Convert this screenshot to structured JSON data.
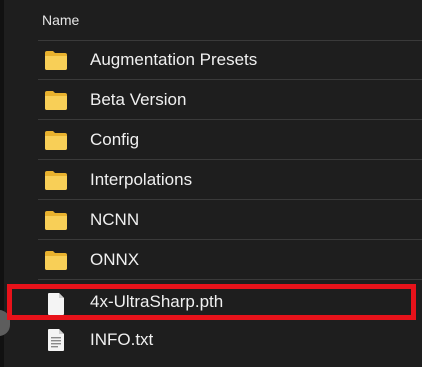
{
  "column_header": "Name",
  "files": [
    {
      "name": "Augmentation Presets",
      "type": "folder",
      "icon": "folder-icon"
    },
    {
      "name": "Beta Version",
      "type": "folder",
      "icon": "folder-icon"
    },
    {
      "name": "Config",
      "type": "folder",
      "icon": "folder-icon"
    },
    {
      "name": "Interpolations",
      "type": "folder",
      "icon": "folder-icon"
    },
    {
      "name": "NCNN",
      "type": "folder",
      "icon": "folder-icon"
    },
    {
      "name": "ONNX",
      "type": "folder",
      "icon": "folder-icon"
    },
    {
      "name": "4x-UltraSharp.pth",
      "type": "file",
      "icon": "document-icon",
      "highlighted": true
    },
    {
      "name": "INFO.txt",
      "type": "text-file",
      "icon": "text-document-icon"
    }
  ],
  "colors": {
    "background": "#1e1e1e",
    "folder": "#f5c84a",
    "highlight_border": "#e8121a"
  }
}
